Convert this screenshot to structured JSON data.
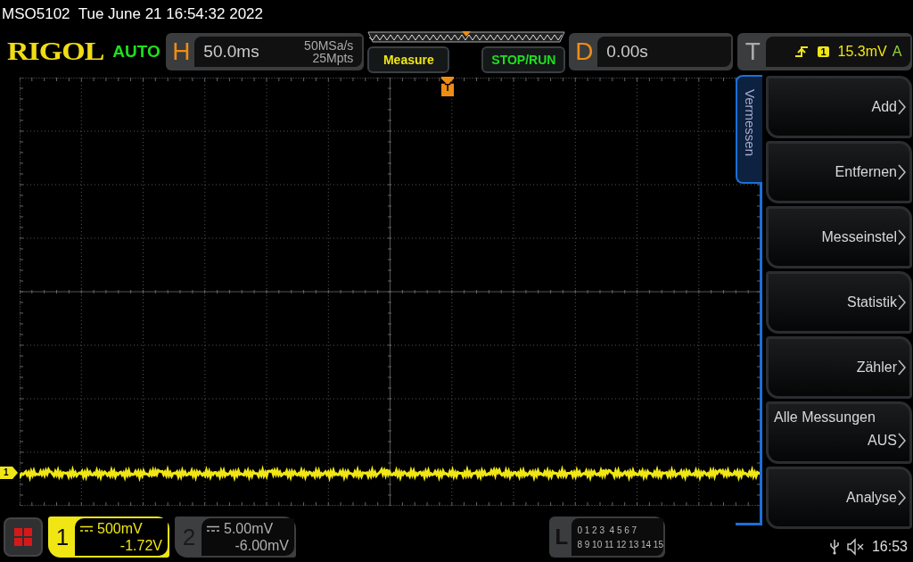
{
  "title_bar": {
    "text": "MSO5102  Tue June 21 16:54:32 2022"
  },
  "header": {
    "logo": "RIGOL",
    "mode": "AUTO",
    "horizontal": {
      "letter": "H",
      "timebase": "50.0ms",
      "sample_rate": "50MSa/s",
      "memory_depth": "25Mpts"
    },
    "buttons": [
      {
        "label": "Measure",
        "kind": "measure"
      },
      {
        "label": "STOP/RUN",
        "kind": "run"
      }
    ],
    "delay": {
      "letter": "D",
      "value": "0.00s"
    },
    "trigger": {
      "letter": "T",
      "source": "1",
      "threshold": "15.3mV",
      "mode": "A"
    }
  },
  "display": {
    "trigger_marker": "T",
    "channel_marker": "1"
  },
  "menu": {
    "tab": "Vermessen",
    "items": [
      {
        "kind": "button",
        "label": "Add"
      },
      {
        "kind": "button",
        "label": "Entfernen"
      },
      {
        "kind": "button",
        "label": "Messeinstel"
      },
      {
        "kind": "button",
        "label": "Statistik"
      },
      {
        "kind": "button",
        "label": "Zähler"
      },
      {
        "kind": "option",
        "title": "Alle Messungen",
        "value": "AUS"
      },
      {
        "kind": "button",
        "label": "Analyse"
      }
    ]
  },
  "channels": [
    {
      "number": "1",
      "scale": "500mV",
      "offset": "-1.72V",
      "active": true
    },
    {
      "number": "2",
      "scale": "5.00mV",
      "offset": "-6.00mV",
      "active": false
    }
  ],
  "logic": {
    "letter": "L",
    "rows": [
      "0 1 2 3  4 5 6 7",
      "8 9 10 11 12 13 14 15"
    ]
  },
  "status": {
    "time": "16:53",
    "muted": true
  }
}
